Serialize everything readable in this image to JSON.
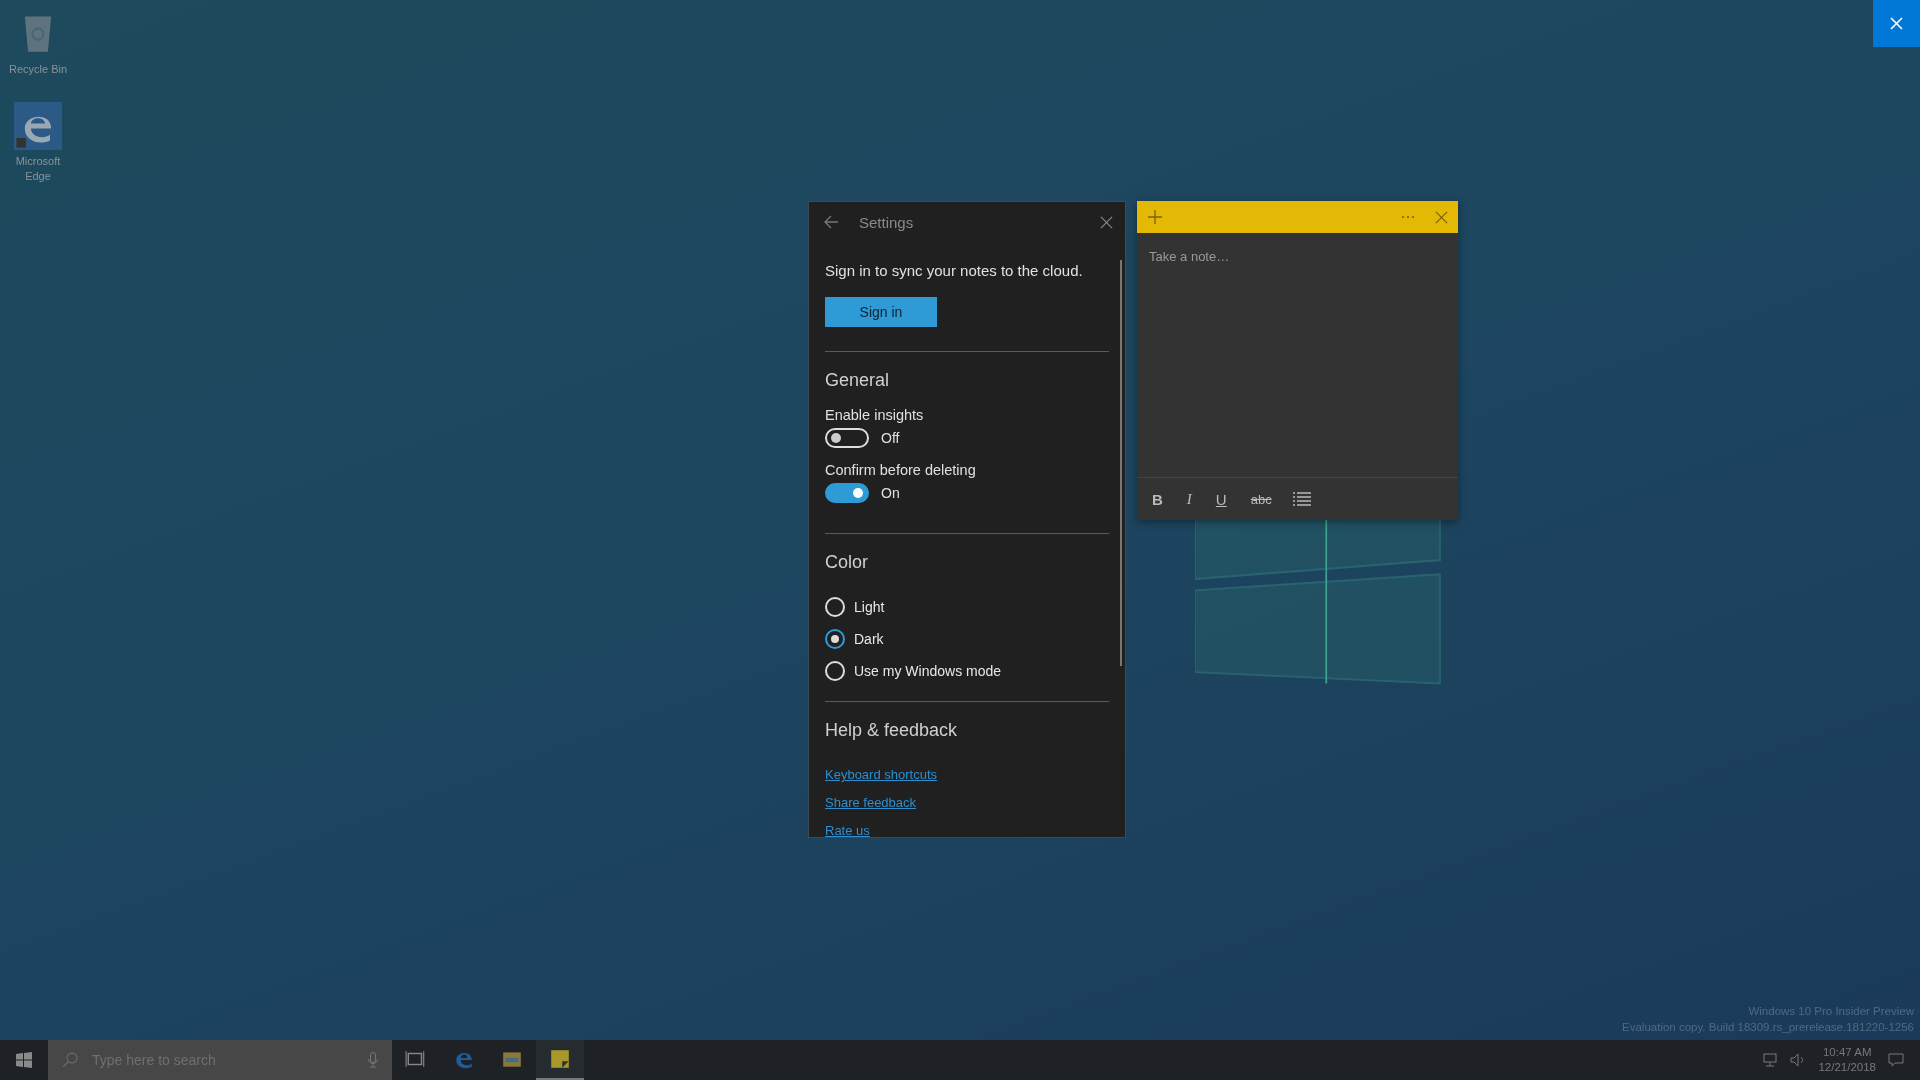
{
  "desktop_icons": [
    {
      "label": "Recycle Bin",
      "kind": "recycle"
    },
    {
      "label": "Microsoft Edge",
      "kind": "edge"
    }
  ],
  "settings": {
    "title": "Settings",
    "sign_in_text": "Sign in to sync your notes to the cloud.",
    "sign_in_button": "Sign in",
    "general": {
      "heading": "General",
      "toggles": [
        {
          "label": "Enable insights",
          "on": false,
          "state_text": "Off"
        },
        {
          "label": "Confirm before deleting",
          "on": true,
          "state_text": "On"
        }
      ]
    },
    "color": {
      "heading": "Color",
      "options": [
        {
          "label": "Light",
          "selected": false
        },
        {
          "label": "Dark",
          "selected": true
        },
        {
          "label": "Use my Windows mode",
          "selected": false
        }
      ]
    },
    "help": {
      "heading": "Help & feedback",
      "links": [
        "Keyboard shortcuts",
        "Share feedback",
        "Rate us"
      ]
    }
  },
  "note": {
    "placeholder": "Take a note…",
    "format_buttons": [
      {
        "kind": "bold",
        "label": "B"
      },
      {
        "kind": "italic",
        "label": "I"
      },
      {
        "kind": "underline",
        "label": "U"
      },
      {
        "kind": "strike",
        "label": "abc"
      },
      {
        "kind": "list"
      }
    ]
  },
  "desktop_info": [
    "Windows 10 Pro Insider Preview",
    "Evaluation copy. Build 18309.rs_prerelease.181220-1256"
  ],
  "taskbar": {
    "search_placeholder": "Type here to search",
    "apps": [
      {
        "kind": "taskview",
        "active": false
      },
      {
        "kind": "edge",
        "active": false
      },
      {
        "kind": "explorer",
        "active": false
      },
      {
        "kind": "notes",
        "active": true
      }
    ],
    "time": "10:47 AM",
    "date": "12/21/2018"
  }
}
